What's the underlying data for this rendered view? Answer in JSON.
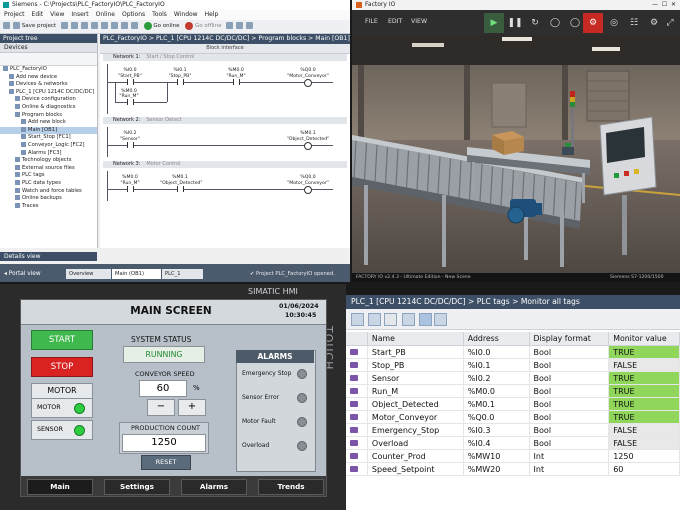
{
  "tia": {
    "title": "Siemens - C:\\Projects\\PLC_FactoryIO\\PLC_FactoryIO",
    "menu": [
      "Project",
      "Edit",
      "View",
      "Insert",
      "Online",
      "Options",
      "Tools",
      "Window",
      "Help"
    ],
    "toolbar": {
      "save": "Save project",
      "go_online": "Go online",
      "go_offline": "Go offline"
    },
    "tree": {
      "header": "Project tree",
      "tab": "Devices",
      "items": [
        {
          "label": "PLC_FactoryIO",
          "indent": 0
        },
        {
          "label": "Add new device",
          "indent": 1
        },
        {
          "label": "Devices & networks",
          "indent": 1
        },
        {
          "label": "PLC_1 [CPU 1214C DC/DC/DC]",
          "indent": 1
        },
        {
          "label": "Device configuration",
          "indent": 2
        },
        {
          "label": "Online & diagnostics",
          "indent": 2
        },
        {
          "label": "Program blocks",
          "indent": 2
        },
        {
          "label": "Add new block",
          "indent": 3
        },
        {
          "label": "Main [OB1]",
          "indent": 3
        },
        {
          "label": "Start_Stop [FC1]",
          "indent": 3
        },
        {
          "label": "Conveyor_Logic [FC2]",
          "indent": 3
        },
        {
          "label": "Alarms [FC3]",
          "indent": 3
        },
        {
          "label": "Technology objects",
          "indent": 2
        },
        {
          "label": "External source files",
          "indent": 2
        },
        {
          "label": "PLC tags",
          "indent": 2
        },
        {
          "label": "PLC data types",
          "indent": 2
        },
        {
          "label": "Watch and force tables",
          "indent": 2
        },
        {
          "label": "Online backups",
          "indent": 2
        },
        {
          "label": "Traces",
          "indent": 2
        }
      ],
      "details": "Details view"
    },
    "editor": {
      "breadcrumb": "PLC_FactoryIO > PLC_1 [CPU 1214C DC/DC/DC] > Program blocks > Main [OB1]",
      "interface": "Block interface",
      "networks": [
        {
          "title": "Network 1:",
          "comment": "Start / Stop Control",
          "contacts": [
            {
              "addr": "%I0.0",
              "name": "\"Start_PB\""
            },
            {
              "addr": "%I0.1",
              "name": "\"Stop_PB\""
            },
            {
              "addr": "%M0.0",
              "name": "\"Run_M\""
            }
          ],
          "coil": {
            "addr": "%Q0.0",
            "name": "\"Motor_Conveyor\""
          },
          "branch": {
            "addr": "%M0.0",
            "name": "\"Run_M\""
          }
        },
        {
          "title": "Network 2:",
          "comment": "Sensor Detect",
          "contacts": [
            {
              "addr": "%I0.2",
              "name": "\"Sensor\""
            }
          ],
          "coil": {
            "addr": "%M0.1",
            "name": "\"Object_Detected\""
          }
        },
        {
          "title": "Network 3:",
          "comment": "Motor Control",
          "contacts": [
            {
              "addr": "%M0.0",
              "name": "\"Run_M\""
            },
            {
              "addr": "%M0.1",
              "name": "\"Object_Detected\""
            }
          ],
          "coil": {
            "addr": "%Q0.0",
            "name": "\"Motor_Conveyor\""
          }
        }
      ]
    },
    "portal": {
      "view": "Portal view",
      "tabs": [
        "Overview",
        "Main (OB1)",
        "PLC_1"
      ],
      "status": "Project PLC_FactoryIO opened."
    }
  },
  "factory": {
    "title": "Factory IO",
    "menu": [
      "FILE",
      "EDIT",
      "VIEW"
    ],
    "status_left": "FACTORY IO v2.4.3 - Ultimate Edition - New Scene",
    "status_right": "Siemens S7-1200/1500"
  },
  "hmi": {
    "title": "MAIN SCREEN",
    "date": "01/06/2024",
    "time": "10:30:45",
    "brand": "SIMATIC HMI",
    "touch": "TOUCH",
    "start": "START",
    "stop": "STOP",
    "motor": "MOTOR",
    "motor_ind": "MOTOR",
    "sensor_ind": "SENSOR",
    "system_status_label": "SYSTEM STATUS",
    "system_status": "RUNNING",
    "conveyor_speed_label": "CONVEYOR SPEED",
    "conveyor_speed": "60",
    "speed_unit": "%",
    "minus": "−",
    "plus": "+",
    "production_count_label": "PRODUCTION COUNT",
    "production_count": "1250",
    "reset": "RESET",
    "alarms": {
      "title": "ALARMS",
      "items": [
        "Emergency Stop",
        "Sensor Error",
        "Motor Fault",
        "Overload"
      ]
    },
    "nav": [
      "Main",
      "Settings",
      "Alarms",
      "Trends"
    ],
    "colors": {
      "start": "#3fb84d",
      "stop": "#d92222",
      "indicator_on": "#2ecc40",
      "indicator_off": "#8a8f96"
    }
  },
  "tags": {
    "breadcrumb": "PLC_1 [CPU 1214C DC/DC/DC] > PLC tags > Monitor all tags",
    "columns": [
      "Name",
      "Address",
      "Display format",
      "Monitor value"
    ],
    "rows": [
      {
        "name": "Start_PB",
        "address": "%I0.0",
        "format": "Bool",
        "value": "TRUE"
      },
      {
        "name": "Stop_PB",
        "address": "%I0.1",
        "format": "Bool",
        "value": "FALSE"
      },
      {
        "name": "Sensor",
        "address": "%I0.2",
        "format": "Bool",
        "value": "TRUE"
      },
      {
        "name": "Run_M",
        "address": "%M0.0",
        "format": "Bool",
        "value": "TRUE"
      },
      {
        "name": "Object_Detected",
        "address": "%M0.1",
        "format": "Bool",
        "value": "TRUE"
      },
      {
        "name": "Motor_Conveyor",
        "address": "%Q0.0",
        "format": "Bool",
        "value": "TRUE"
      },
      {
        "name": "Emergency_Stop",
        "address": "%I0.3",
        "format": "Bool",
        "value": "FALSE"
      },
      {
        "name": "Overload",
        "address": "%I0.4",
        "format": "Bool",
        "value": "FALSE"
      },
      {
        "name": "Counter_Prod",
        "address": "%MW10",
        "format": "Int",
        "value": "1250"
      },
      {
        "name": "Speed_Setpoint",
        "address": "%MW20",
        "format": "Int",
        "value": "60"
      }
    ]
  }
}
